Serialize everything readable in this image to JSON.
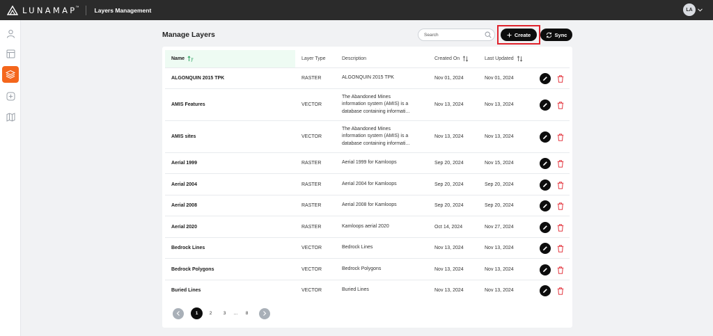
{
  "app": {
    "logo_text": "LUNAMAP",
    "logo_tm": "™",
    "title": "Layers Management",
    "user_initials": "LA"
  },
  "sidebar": {
    "items": [
      {
        "icon": "user-icon",
        "active": false
      },
      {
        "icon": "layout-icon",
        "active": false
      },
      {
        "icon": "layers-icon",
        "active": true
      },
      {
        "icon": "add-square-icon",
        "active": false
      },
      {
        "icon": "map-icon",
        "active": false
      }
    ]
  },
  "page": {
    "title": "Manage Layers",
    "search_placeholder": "Search",
    "create_label": "Create",
    "sync_label": "Sync"
  },
  "colors": {
    "accent": "#f4661c",
    "highlight": "#e0212b",
    "sorted_header_bg": "#eefbf3",
    "delete_icon": "#e0212b"
  },
  "table": {
    "headers": {
      "name": "Name",
      "type": "Layer Type",
      "description": "Description",
      "created": "Created On",
      "updated": "Last Updated"
    },
    "rows": [
      {
        "name": "ALGONQUIN 2015 TPK",
        "type": "RASTER",
        "desc": [
          "ALGONQUIN 2015 TPK"
        ],
        "created": "Nov 01, 2024",
        "updated": "Nov 01, 2024"
      },
      {
        "name": "AMIS Features",
        "type": "VECTOR",
        "desc": [
          "The Abandoned Mines",
          "information system (AMIS) is a",
          "database containing informati..."
        ],
        "created": "Nov 13, 2024",
        "updated": "Nov 13, 2024"
      },
      {
        "name": "AMIS sites",
        "type": "VECTOR",
        "desc": [
          "The Abandoned Mines",
          "information system (AMIS) is a",
          "database containing informati..."
        ],
        "created": "Nov 13, 2024",
        "updated": "Nov 13, 2024"
      },
      {
        "name": "Aerial 1999",
        "type": "RASTER",
        "desc": [
          "Aerial 1999 for Kamloops"
        ],
        "created": "Sep 20, 2024",
        "updated": "Nov 15, 2024"
      },
      {
        "name": "Aerial 2004",
        "type": "RASTER",
        "desc": [
          "Aerial 2004 for Kamloops"
        ],
        "created": "Sep 20, 2024",
        "updated": "Sep 20, 2024"
      },
      {
        "name": "Aerial 2008",
        "type": "RASTER",
        "desc": [
          "Aerial 2008 for Kamloops"
        ],
        "created": "Sep 20, 2024",
        "updated": "Sep 20, 2024"
      },
      {
        "name": "Aerial 2020",
        "type": "RASTER",
        "desc": [
          "Kamloops aerial 2020"
        ],
        "created": "Oct 14, 2024",
        "updated": "Nov 27, 2024"
      },
      {
        "name": "Bedrock Lines",
        "type": "VECTOR",
        "desc": [
          "Bedrock Lines"
        ],
        "created": "Nov 13, 2024",
        "updated": "Nov 13, 2024"
      },
      {
        "name": "Bedrock Polygons",
        "type": "VECTOR",
        "desc": [
          "Bedrock Polygons"
        ],
        "created": "Nov 13, 2024",
        "updated": "Nov 13, 2024"
      },
      {
        "name": "Buried Lines",
        "type": "VECTOR",
        "desc": [
          "Buried Lines"
        ],
        "created": "Nov 13, 2024",
        "updated": "Nov 13, 2024"
      }
    ]
  },
  "pagination": {
    "pages": [
      "1",
      "2",
      "3",
      "...",
      "8"
    ],
    "current": "1"
  }
}
